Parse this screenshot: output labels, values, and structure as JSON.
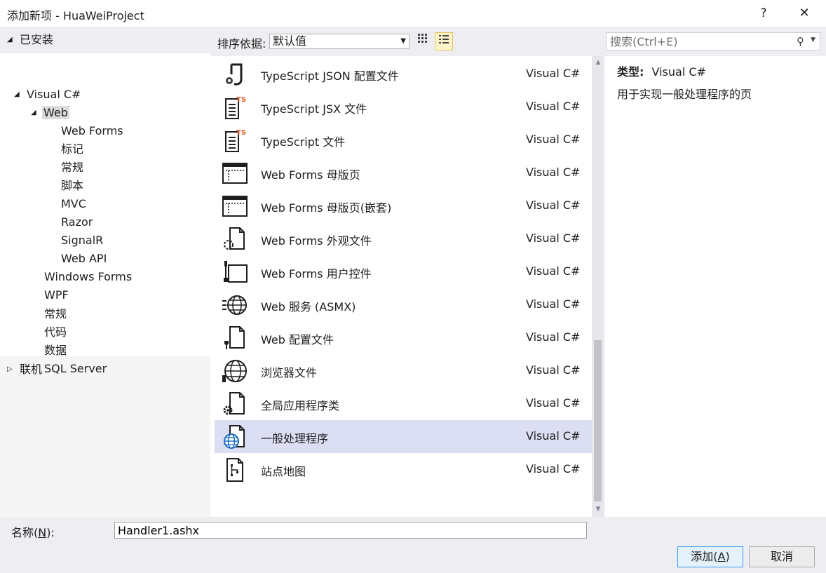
{
  "window": {
    "title": "添加新项 - HuaWeiProject",
    "help": "?",
    "close": "✕"
  },
  "tree": {
    "installed": "已安装",
    "visual_csharp": "Visual C#",
    "web": "Web",
    "web_children": [
      "Web Forms",
      "标记",
      "常规",
      "脚本",
      "MVC",
      "Razor",
      "SignalR",
      "Web API"
    ],
    "siblings": [
      "Windows Forms",
      "WPF",
      "常规",
      "代码",
      "数据",
      "SQL Server"
    ],
    "online": "联机"
  },
  "toolbar": {
    "sort_label": "排序依据:",
    "sort_value": "默认值",
    "search_placeholder": "搜索(Ctrl+E)"
  },
  "items": [
    {
      "name": "TypeScript JSON 配置文件",
      "lang": "Visual C#",
      "icon": "ts-json-config-icon"
    },
    {
      "name": "TypeScript JSX 文件",
      "lang": "Visual C#",
      "icon": "ts-file-icon"
    },
    {
      "name": "TypeScript 文件",
      "lang": "Visual C#",
      "icon": "ts-file-icon"
    },
    {
      "name": "Web Forms 母版页",
      "lang": "Visual C#",
      "icon": "master-page-icon"
    },
    {
      "name": "Web Forms 母版页(嵌套)",
      "lang": "Visual C#",
      "icon": "master-page-icon"
    },
    {
      "name": "Web Forms 外观文件",
      "lang": "Visual C#",
      "icon": "skin-file-icon"
    },
    {
      "name": "Web Forms 用户控件",
      "lang": "Visual C#",
      "icon": "user-control-icon"
    },
    {
      "name": "Web 服务 (ASMX)",
      "lang": "Visual C#",
      "icon": "web-service-icon"
    },
    {
      "name": "Web 配置文件",
      "lang": "Visual C#",
      "icon": "web-config-icon"
    },
    {
      "name": "浏览器文件",
      "lang": "Visual C#",
      "icon": "browser-file-icon"
    },
    {
      "name": "全局应用程序类",
      "lang": "Visual C#",
      "icon": "global-app-icon"
    },
    {
      "name": "一般处理程序",
      "lang": "Visual C#",
      "icon": "generic-handler-icon"
    },
    {
      "name": "站点地图",
      "lang": "Visual C#",
      "icon": "sitemap-icon"
    }
  ],
  "details": {
    "type_label": "类型:",
    "type_value": "Visual C#",
    "description": "用于实现一般处理程序的页"
  },
  "bottom": {
    "name_label": "名称(N):",
    "name_value": "Handler1.ashx",
    "add_label": "添加(A)",
    "cancel_label": "取消"
  }
}
